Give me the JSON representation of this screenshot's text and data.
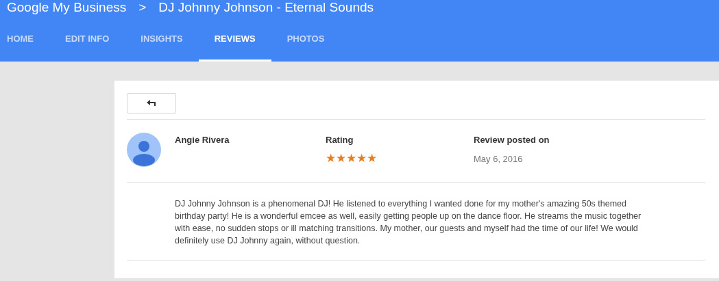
{
  "header": {
    "app_title": "Google My Business",
    "separator": ">",
    "business_name": "DJ Johnny Johnson - Eternal Sounds"
  },
  "tabs": [
    {
      "label": "HOME",
      "selected": false
    },
    {
      "label": "EDIT INFO",
      "selected": false
    },
    {
      "label": "INSIGHTS",
      "selected": false
    },
    {
      "label": "REVIEWS",
      "selected": true
    },
    {
      "label": "PHOTOS",
      "selected": false
    }
  ],
  "review": {
    "reviewer": "Angie Rivera",
    "rating_label": "Rating",
    "stars": 5,
    "date_label": "Review posted on",
    "date": "May 6, 2016",
    "text": "DJ Johnny Johnson is a phenomenal DJ! He listened to everything I wanted done for my mother's amazing 50s themed birthday party! He is a wonderful emcee as well, easily getting people up on the dance floor. He streams the music together with ease, no sudden stops or ill matching transitions. My mother, our guests and myself had the time of our life! We would definitely use DJ Johnny again, without question."
  }
}
